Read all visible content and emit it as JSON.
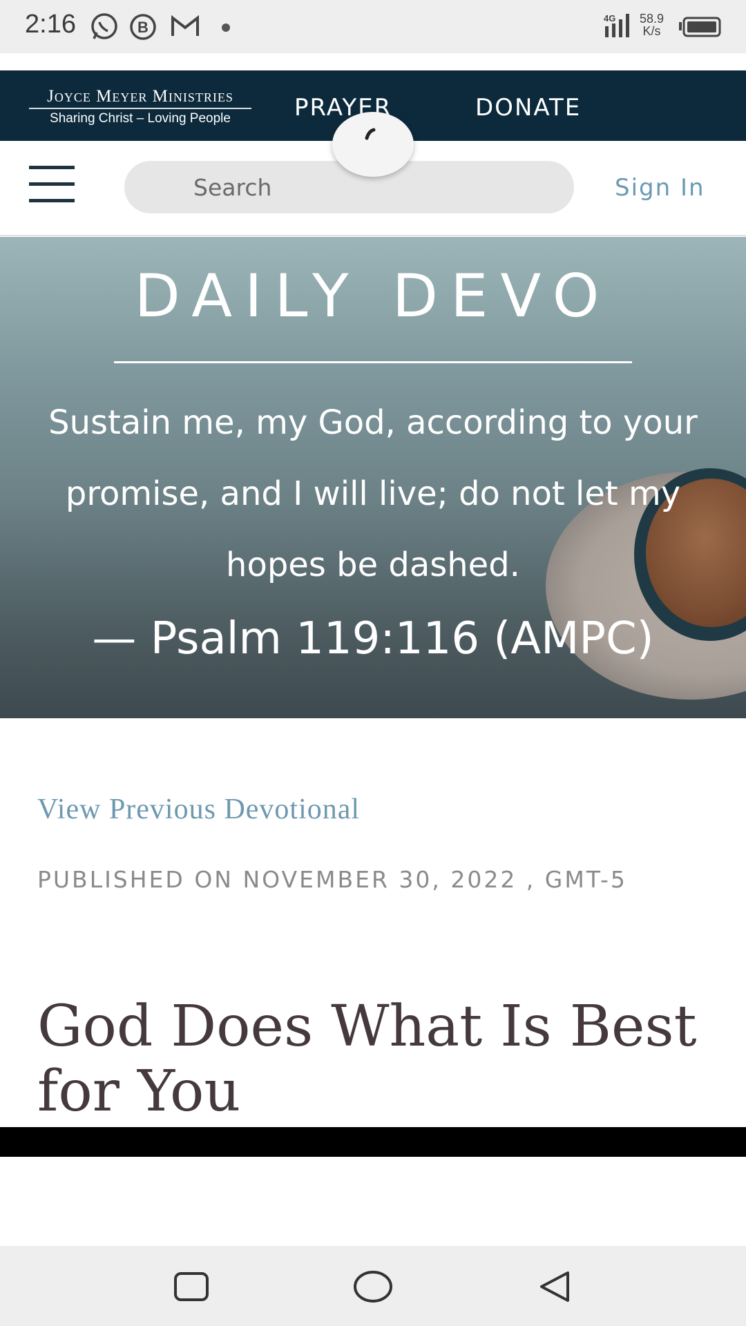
{
  "status_bar": {
    "time": "2:16",
    "network_type": "4G",
    "net_speed_value": "58.9",
    "net_speed_unit": "K/s",
    "icons": [
      "whatsapp-icon",
      "b-icon",
      "gmail-icon",
      "dot-icon",
      "signal-icon",
      "battery-icon"
    ]
  },
  "brand": {
    "name": "Joyce Meyer Ministries",
    "tagline": "Sharing Christ – Loving People"
  },
  "top_nav": {
    "prayer": "PRAYER",
    "donate": "DONATE"
  },
  "search": {
    "placeholder": "Search",
    "value": ""
  },
  "account": {
    "sign_in": "Sign In"
  },
  "hero": {
    "title": "DAILY DEVO",
    "verse": "Sustain me, my God, according to your promise, and I will live; do not let my hopes be dashed.",
    "reference": "— Psalm 119:116 (AMPC)"
  },
  "article": {
    "previous_link": "View Previous Devotional",
    "published": "PUBLISHED ON NOVEMBER 30, 2022 , GMT-5",
    "title": "God Does What Is Best for You"
  },
  "nav_bar": {
    "buttons": [
      "recents-button",
      "home-button",
      "back-button"
    ]
  },
  "colors": {
    "brand_navy": "#0c2a3b",
    "link_blue": "#6d99b0",
    "title_text": "#45393d"
  }
}
